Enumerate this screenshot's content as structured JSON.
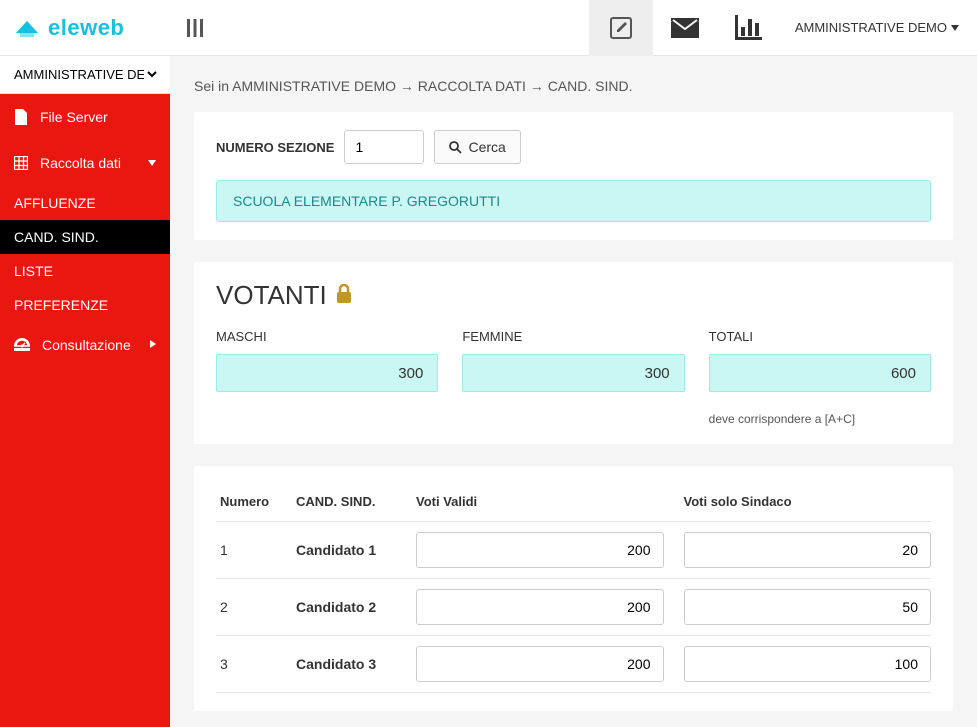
{
  "brand": "eleweb",
  "topbar": {
    "user_label": "AMMINISTRATIVE DEMO"
  },
  "sidebar": {
    "select_value": "AMMINISTRATIVE DEMO",
    "file_server": "File Server",
    "raccolta_dati": "Raccolta dati",
    "subs": {
      "affluenze": "AFFLUENZE",
      "cand_sind": "CAND. SIND.",
      "liste": "LISTE",
      "preferenze": "PREFERENZE"
    },
    "consultazione": "Consultazione"
  },
  "breadcrumb": {
    "prefix": "Sei in ",
    "p1": "AMMINISTRATIVE DEMO",
    "p2": "RACCOLTA DATI",
    "p3": "CAND. SIND."
  },
  "search": {
    "label": "NUMERO SEZIONE",
    "value": "1",
    "button": "Cerca"
  },
  "section_name": "SCUOLA ELEMENTARE P. GREGORUTTI",
  "votanti": {
    "title": "VOTANTI",
    "maschi_label": "MASCHI",
    "femmine_label": "FEMMINE",
    "totali_label": "TOTALI",
    "maschi": "300",
    "femmine": "300",
    "totali": "600",
    "hint": "deve corrispondere a [A+C]"
  },
  "cand_table": {
    "headers": {
      "numero": "Numero",
      "cand": "CAND. SIND.",
      "voti": "Voti Validi",
      "sind": "Voti solo Sindaco"
    },
    "rows": [
      {
        "n": "1",
        "name": "Candidato 1",
        "voti": "200",
        "sind": "20"
      },
      {
        "n": "2",
        "name": "Candidato 2",
        "voti": "200",
        "sind": "50"
      },
      {
        "n": "3",
        "name": "Candidato 3",
        "voti": "200",
        "sind": "100"
      }
    ]
  }
}
